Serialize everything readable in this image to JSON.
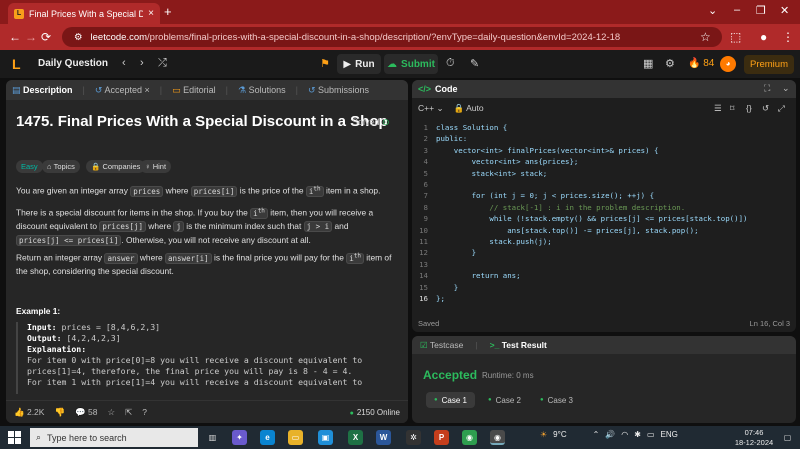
{
  "browser": {
    "tab_title": "Final Prices With a Special Disco",
    "tab_close": "×",
    "new_tab": "+",
    "url_host": "leetcode.com",
    "url_path": "/problems/final-prices-with-a-special-discount-in-a-shop/description/?envType=daily-question&envId=2024-12-18",
    "window_controls": [
      "⌄",
      "–",
      "❐",
      "✕"
    ]
  },
  "header": {
    "logo": "L",
    "daily_question": "Daily Question",
    "run_label": "Run",
    "submit_label": "Submit",
    "streak_count": "84",
    "premium_label": "Premium"
  },
  "left_tabs": [
    "Description",
    "Accepted",
    "Editorial",
    "Solutions",
    "Submissions"
  ],
  "problem": {
    "title": "1475. Final Prices With a Special Discount in a Shop",
    "solved_label": "Solved",
    "tags": [
      "Easy",
      "Topics",
      "Companies",
      "Hint"
    ],
    "p1_a": "You are given an integer array ",
    "p1_code1": "prices",
    "p1_b": " where ",
    "p1_code2": "prices[i]",
    "p1_c": " is the price of the ",
    "p1_code3": "i",
    "p1_sup": "th",
    "p1_d": " item in a shop.",
    "p2_a": "There is a special discount for items in the shop. If you buy the ",
    "p2_code1": "i",
    "p2_sup": "th",
    "p2_b": " item, then you will receive a discount equivalent to ",
    "p2_code2": "prices[j]",
    "p2_c": " where ",
    "p2_code3": "j",
    "p2_d": " is the minimum index such that ",
    "p2_code4": "j > i",
    "p2_e": " and ",
    "p2_code5": "prices[j] <= prices[i]",
    "p2_f": ". Otherwise, you will not receive any discount at all.",
    "p3_a": "Return an integer array ",
    "p3_code1": "answer",
    "p3_b": " where ",
    "p3_code2": "answer[i]",
    "p3_c": " is the final price you will pay for the ",
    "p3_code3": "i",
    "p3_sup": "th",
    "p3_d": " item of the shop, considering the special discount.",
    "example_title": "Example 1:",
    "input_label": "Input:",
    "input_value": " prices = [8,4,6,2,3]",
    "output_label": "Output:",
    "output_value": " [4,2,4,2,3]",
    "explanation_label": "Explanation:",
    "expl_line1": "For item 0 with price[0]=8 you will receive a discount equivalent to",
    "expl_line2": "prices[1]=4, therefore, the final price you will pay is 8 - 4 = 4.",
    "expl_line3": "For item 1 with price[1]=4 you will receive a discount equivalent to"
  },
  "left_footer": {
    "likes": "2.2K",
    "comments": "58",
    "online": "2150 Online"
  },
  "code_panel": {
    "title": "Code",
    "language": "C++",
    "auto_label": "Auto",
    "saved": "Saved",
    "position": "Ln 16, Col 3",
    "lines": [
      "class Solution {",
      "public:",
      "    vector<int> finalPrices(vector<int>& prices) {",
      "        vector<int> ans{prices};",
      "        stack<int> stack;",
      "",
      "        for (int j = 0; j < prices.size(); ++j) {",
      "            // stack[-1] : i in the problem description.",
      "            while (!stack.empty() && prices[j] <= prices[stack.top()])",
      "                ans[stack.top()] -= prices[j], stack.pop();",
      "            stack.push(j);",
      "        }",
      "",
      "        return ans;",
      "    }",
      "};"
    ]
  },
  "test_panel": {
    "tabs": [
      "Testcase",
      "Test Result"
    ],
    "status": "Accepted",
    "runtime": "Runtime: 0 ms",
    "cases": [
      "Case 1",
      "Case 2",
      "Case 3"
    ]
  },
  "taskbar": {
    "search_placeholder": "Type here to search",
    "temperature": "9°C",
    "language": "ENG",
    "time": "07:46",
    "date": "18-12-2024"
  },
  "colors": {
    "accent_green": "#2cbb5d",
    "leetcode_orange": "#ffa116",
    "browser_red": "#b02a2a"
  }
}
